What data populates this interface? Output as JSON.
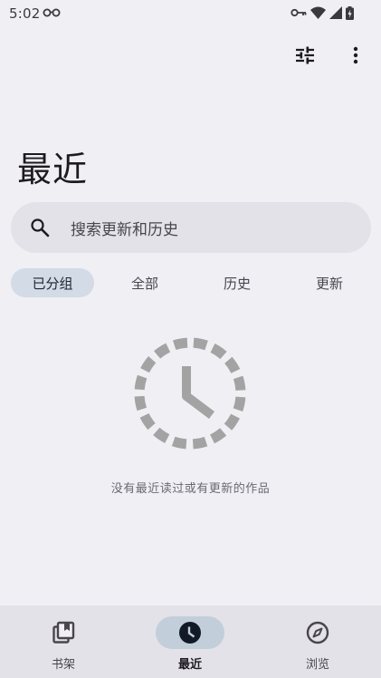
{
  "status_bar": {
    "time": "5:02",
    "icons": [
      "glasses-icon",
      "vpn-key-icon",
      "wifi-icon",
      "signal-icon",
      "battery-icon"
    ]
  },
  "toolbar": {
    "icons": [
      "filter-icon",
      "more-vert-icon"
    ]
  },
  "page": {
    "title": "最近"
  },
  "search": {
    "placeholder": "搜索更新和历史",
    "icon": "search-icon"
  },
  "tabs": [
    {
      "label": "已分组",
      "active": true
    },
    {
      "label": "全部",
      "active": false
    },
    {
      "label": "历史",
      "active": false
    },
    {
      "label": "更新",
      "active": false
    }
  ],
  "empty_state": {
    "icon": "clock-dashed-icon",
    "message": "没有最近读过或有更新的作品"
  },
  "bottom_nav": {
    "items": [
      {
        "label": "书架",
        "icon": "library-books-icon",
        "active": false
      },
      {
        "label": "最近",
        "icon": "clock-icon",
        "active": true
      },
      {
        "label": "浏览",
        "icon": "compass-icon",
        "active": false
      }
    ]
  },
  "colors": {
    "background": "#f0eff4",
    "surface": "#e3e2e8",
    "active_pill": "#d2dbe6",
    "nav_active_pill": "#c3cedb",
    "icon_gray": "#a3a3a3"
  }
}
